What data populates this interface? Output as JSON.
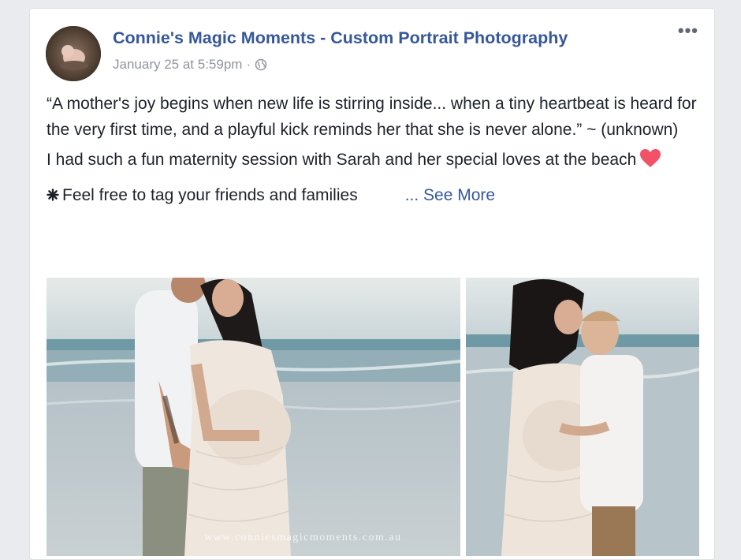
{
  "post": {
    "page_name": "Connie's Magic Moments - Custom Portrait Photography",
    "timestamp": "January 25 at 5:59pm",
    "separator": "·",
    "privacy_icon": "globe-icon",
    "more_options": "•••",
    "quote": "“A mother's joy begins when new life is stirring inside... when a tiny heartbeat is heard for the very first time, and a playful kick reminds her that she is never alone.” ~ (unknown)",
    "session_text": "I had such a fun maternity session with Sarah and her special loves at the beach",
    "heart_icon": "heart-icon",
    "tag_text": "Feel free to tag your friends and families",
    "tag_icon": "asterisk-icon",
    "see_more": "... See More"
  },
  "photos": [
    {
      "alt_subject": "couple-maternity-beach",
      "watermark": "www.conniesmagicmoments.com.au"
    },
    {
      "alt_subject": "mother-son-maternity-beach"
    }
  ],
  "colors": {
    "link": "#365899",
    "text": "#1d2129",
    "meta": "#90949c",
    "heart": "#f25268"
  }
}
